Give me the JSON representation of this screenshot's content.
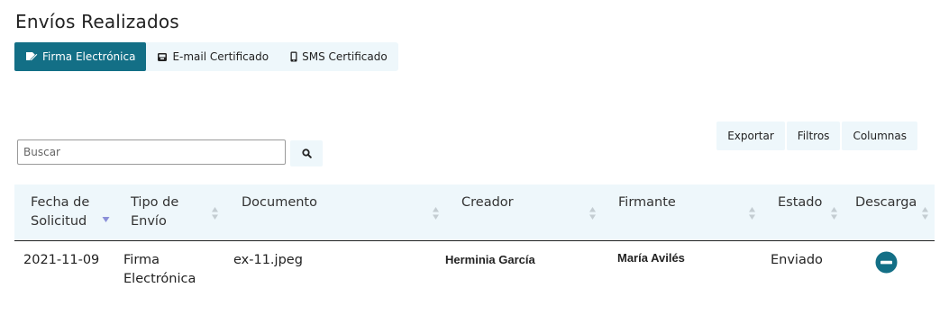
{
  "page": {
    "title": "Envíos Realizados"
  },
  "tabs": [
    {
      "label": "Firma Electrónica",
      "icon": "signature-icon",
      "active": true
    },
    {
      "label": "E-mail Certificado",
      "icon": "inbox-icon",
      "active": false
    },
    {
      "label": "SMS Certificado",
      "icon": "mobile-icon",
      "active": false
    }
  ],
  "toolbar": {
    "export_label": "Exportar",
    "filters_label": "Filtros",
    "columns_label": "Columnas"
  },
  "search": {
    "placeholder": "Buscar",
    "value": ""
  },
  "table": {
    "columns": [
      {
        "line1": "Fecha de",
        "line2": "Solicitud",
        "sort": "desc"
      },
      {
        "line1": "Tipo de",
        "line2": "Envío",
        "sort": "none"
      },
      {
        "line1": "Documento",
        "line2": "",
        "sort": "none"
      },
      {
        "line1": "Creador",
        "line2": "",
        "sort": "none"
      },
      {
        "line1": "Firmante",
        "line2": "",
        "sort": "none"
      },
      {
        "line1": "Estado",
        "line2": "",
        "sort": "none"
      },
      {
        "line1": "Descarga",
        "line2": "",
        "sort": "none"
      }
    ],
    "rows": [
      {
        "fecha": "2021-11-09",
        "tipo_line1": "Firma",
        "tipo_line2": "Electrónica",
        "documento": "ex-11.jpeg",
        "creador": "Herminia García",
        "firmante": "María Avilés",
        "estado": "Enviado",
        "descarga_icon": "minus-circle-icon"
      }
    ]
  },
  "colors": {
    "accent": "#136f86",
    "panel": "#eef7fb",
    "sort_active": "#8a8fd8",
    "sort_inactive": "#c4cdd2"
  }
}
